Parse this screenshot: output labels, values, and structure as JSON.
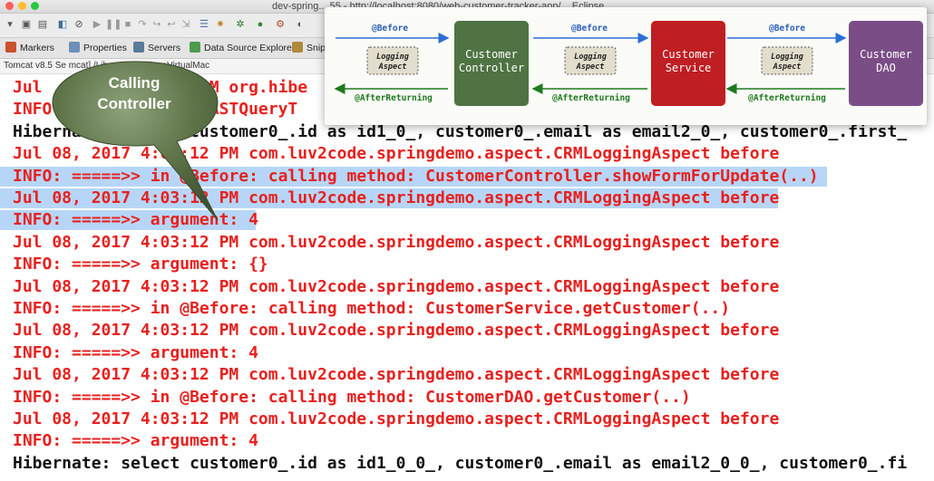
{
  "window": {
    "title": "dev-spring... 55 - http://localhost:8080/web-customer-tracker-aop/... Eclipse"
  },
  "toolbar": {
    "icons": [
      "new-icon",
      "save-icon",
      "print-icon",
      "debug-icon",
      "run-icon",
      "stop-icon",
      "external-tools-icon",
      "search-icon"
    ]
  },
  "tabs": [
    {
      "label": "Markers",
      "icon": "markers-icon",
      "color": "#c9512b"
    },
    {
      "label": "Properties",
      "icon": "properties-icon",
      "color": "#6d8fb8"
    },
    {
      "label": "Servers",
      "icon": "servers-icon",
      "color": "#5a7a9a"
    },
    {
      "label": "Data Source Explorer",
      "icon": "data-source-icon",
      "color": "#4e9a4e"
    },
    {
      "label": "Snipp",
      "icon": "snippets-icon",
      "color": "#b08a3a"
    }
  ],
  "console_path": "Tomcat v8.5 Se                    mcat] /Library/Java/JavaVirtualMac",
  "bubble": {
    "line1": "Calling",
    "line2": "Controller"
  },
  "diagram": {
    "boxes": [
      {
        "label1": "Customer",
        "label2": "Controller",
        "color": "#4f7343"
      },
      {
        "label1": "Customer",
        "label2": "Service",
        "color": "#bf1e22"
      },
      {
        "label1": "Customer",
        "label2": "DAO",
        "color": "#7b4d87"
      }
    ],
    "aspect": {
      "label1": "Logging",
      "label2": "Aspect"
    },
    "before_label": "@Before",
    "after_label": "@AfterReturning",
    "arrow_before_color": "#2a6fd6",
    "arrow_after_color": "#1e7a1e"
  },
  "console": {
    "lines": [
      {
        "text": "Jul                PM org.hibe",
        "color": "red"
      },
      {
        "text": "INFO:          sing ASTQueryT",
        "color": "red"
      },
      {
        "text": "Hibernate: sele t customer0_.id as id1_0_, customer0_.email as email2_0_, customer0_.first_",
        "color": "black"
      },
      {
        "text": "Jul 08, 2017 4:0 :12 PM com.luv2code.springdemo.aspect.CRMLoggingAspect before",
        "color": "red"
      },
      {
        "text": "INFO: =====>> in @Before: calling method: CustomerController.showFormForUpdate(..)",
        "color": "red"
      },
      {
        "text": "Jul 08, 2017 4:03:12 PM com.luv2code.springdemo.aspect.CRMLoggingAspect before",
        "color": "red"
      },
      {
        "text": "INFO: =====>> argument: 4",
        "color": "red"
      },
      {
        "text": "Jul 08, 2017 4:03:12 PM com.luv2code.springdemo.aspect.CRMLoggingAspect before",
        "color": "red"
      },
      {
        "text": "INFO: =====>> argument: {}",
        "color": "red"
      },
      {
        "text": "Jul 08, 2017 4:03:12 PM com.luv2code.springdemo.aspect.CRMLoggingAspect before",
        "color": "red"
      },
      {
        "text": "INFO: =====>> in @Before: calling method: CustomerService.getCustomer(..)",
        "color": "red"
      },
      {
        "text": "Jul 08, 2017 4:03:12 PM com.luv2code.springdemo.aspect.CRMLoggingAspect before",
        "color": "red"
      },
      {
        "text": "INFO: =====>> argument: 4",
        "color": "red"
      },
      {
        "text": "Jul 08, 2017 4:03:12 PM com.luv2code.springdemo.aspect.CRMLoggingAspect before",
        "color": "red"
      },
      {
        "text": "INFO: =====>> in @Before: calling method: CustomerDAO.getCustomer(..)",
        "color": "red"
      },
      {
        "text": "Jul 08, 2017 4:03:12 PM com.luv2code.springdemo.aspect.CRMLoggingAspect before",
        "color": "red"
      },
      {
        "text": "INFO: =====>> argument: 4",
        "color": "red"
      },
      {
        "text": "Hibernate: select customer0_.id as id1_0_0_, customer0_.email as email2_0_0_, customer0_.fi",
        "color": "black"
      }
    ],
    "highlighted_lines": [
      4,
      5,
      6
    ]
  }
}
